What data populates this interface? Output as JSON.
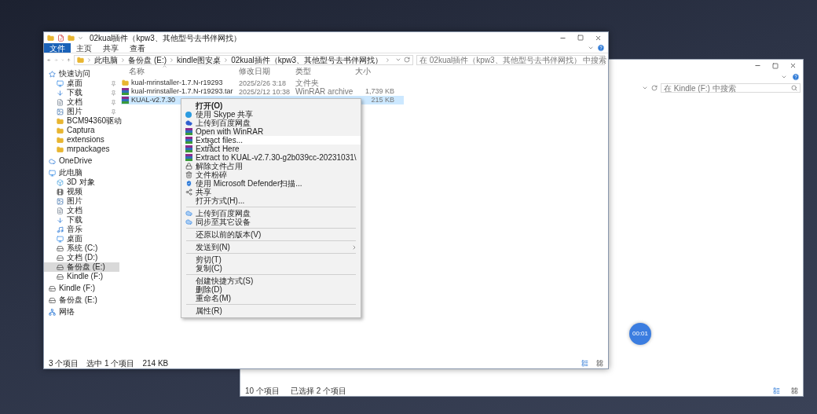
{
  "desktop": {
    "timer_badge": "00:01"
  },
  "back_window": {
    "search": {
      "placeholder": "在 Kindle (F:) 中搜索"
    },
    "status_bar": {
      "item_count": "10 个项目",
      "selection": "已选择 2 个项目"
    }
  },
  "window": {
    "title": "02kual插件（kpw3、其他型号去书伴网找）",
    "ribbon_tabs": [
      {
        "label": "文件",
        "selected": true
      },
      {
        "label": "主页",
        "selected": false
      },
      {
        "label": "共享",
        "selected": false
      },
      {
        "label": "查看",
        "selected": false
      }
    ],
    "address": {
      "path": [
        "此电脑",
        "备份盘 (E:)",
        "kindle图安桌",
        "02kual插件（kpw3、其他型号去书伴网找）"
      ]
    },
    "search": {
      "placeholder": "在 02kual插件（kpw3、其他型号去书伴网找） 中搜索"
    },
    "nav": [
      {
        "label": "快速访问",
        "kind": "star",
        "selected": false,
        "children": [
          {
            "label": "桌面",
            "kind": "desktop",
            "selected": false,
            "pinned": true
          },
          {
            "label": "下载",
            "kind": "download",
            "selected": false,
            "pinned": true
          },
          {
            "label": "文档",
            "kind": "document",
            "selected": false,
            "pinned": true
          },
          {
            "label": "图片",
            "kind": "picture",
            "selected": false,
            "pinned": true
          },
          {
            "label": "BCM94360驱动",
            "kind": "folder",
            "selected": false,
            "pinned": false
          },
          {
            "label": "Captura",
            "kind": "folder",
            "selected": false,
            "pinned": false
          },
          {
            "label": "extensions",
            "kind": "folder",
            "selected": false,
            "pinned": false
          },
          {
            "label": "mrpackages",
            "kind": "folder",
            "selected": false,
            "pinned": false
          }
        ]
      },
      {
        "label": "OneDrive",
        "kind": "cloud",
        "selected": false
      },
      {
        "label": "此电脑",
        "kind": "pc",
        "selected": false,
        "children": [
          {
            "label": "3D 对象",
            "kind": "cube",
            "selected": false
          },
          {
            "label": "视频",
            "kind": "video",
            "selected": false
          },
          {
            "label": "图片",
            "kind": "picture",
            "selected": false
          },
          {
            "label": "文档",
            "kind": "document",
            "selected": false
          },
          {
            "label": "下载",
            "kind": "download",
            "selected": false
          },
          {
            "label": "音乐",
            "kind": "music",
            "selected": false
          },
          {
            "label": "桌面",
            "kind": "desktop",
            "selected": false
          },
          {
            "label": "系统 (C:)",
            "kind": "drive",
            "selected": false
          },
          {
            "label": "文档 (D:)",
            "kind": "drive",
            "selected": false
          },
          {
            "label": "备份盘 (E:)",
            "kind": "drive",
            "selected": true
          },
          {
            "label": "Kindle (F:)",
            "kind": "drive",
            "selected": false
          }
        ]
      },
      {
        "label": "Kindle (F:)",
        "kind": "drive",
        "selected": false
      },
      {
        "label": "备份盘 (E:)",
        "kind": "drive",
        "selected": false
      },
      {
        "label": "网络",
        "kind": "network",
        "selected": false
      }
    ],
    "table": {
      "columns": [
        "名称",
        "修改日期",
        "类型",
        "大小"
      ],
      "rows": [
        {
          "kind": "folder",
          "name": "kual-mrinstaller-1.7.N-r19293",
          "date": "2025/2/26 3:18",
          "type": "文件夹",
          "selected": false
        },
        {
          "kind": "archive",
          "name": "kual-mrinstaller-1.7.N-r19293.tar",
          "date": "2025/2/12 10:38",
          "type": "WinRAR archive",
          "size": "1,739 KB",
          "selected": false
        },
        {
          "kind": "archive",
          "name": "KUAL-v2.7.30",
          "size": "215 KB",
          "selected": true
        }
      ]
    },
    "status_bar": {
      "item_count": "3 个项目",
      "selection": "选中 1 个项目",
      "size": "214 KB"
    }
  },
  "context_menu": [
    {
      "kind": "plain",
      "label": "打开(O)",
      "default": true,
      "highlighted": false
    },
    {
      "kind": "skype",
      "label": "使用 Skype 共享",
      "highlighted": false
    },
    {
      "kind": "baidu",
      "label": "上传到百度网盘",
      "highlighted": false
    },
    {
      "kind": "winrar",
      "label": "Open with WinRAR",
      "highlighted": false
    },
    {
      "kind": "winrar",
      "label": "Extract files...",
      "highlighted": true
    },
    {
      "kind": "winrar",
      "label": "Extract Here",
      "highlighted": false
    },
    {
      "kind": "winrar",
      "label": "Extract to KUAL-v2.7.30-g2b039cc-20231031\\",
      "highlighted": false
    },
    {
      "kind": "lock",
      "label": "解除文件占用",
      "highlighted": false
    },
    {
      "kind": "shred",
      "label": "文件粉碎",
      "highlighted": false
    },
    {
      "kind": "shield",
      "label": "使用 Microsoft Defender扫描...",
      "highlighted": false
    },
    {
      "kind": "share",
      "label": "共享",
      "highlighted": false
    },
    {
      "kind": "plain",
      "label": "打开方式(H)...",
      "highlighted": false
    },
    {
      "kind": "separator"
    },
    {
      "kind": "cloud",
      "label": "上传到百度网盘",
      "highlighted": false
    },
    {
      "kind": "cloud",
      "label": "同步至其它设备",
      "highlighted": false
    },
    {
      "kind": "separator"
    },
    {
      "kind": "plain",
      "label": "还原以前的版本(V)",
      "highlighted": false
    },
    {
      "kind": "separator"
    },
    {
      "kind": "plain",
      "label": "发送到(N)",
      "submenu": true,
      "highlighted": false
    },
    {
      "kind": "separator"
    },
    {
      "kind": "plain",
      "label": "剪切(T)",
      "highlighted": false
    },
    {
      "kind": "plain",
      "label": "复制(C)",
      "highlighted": false
    },
    {
      "kind": "separator"
    },
    {
      "kind": "plain",
      "label": "创建快捷方式(S)",
      "highlighted": false
    },
    {
      "kind": "plain",
      "label": "删除(D)",
      "highlighted": false
    },
    {
      "kind": "plain",
      "label": "重命名(M)",
      "highlighted": false
    },
    {
      "kind": "separator"
    },
    {
      "kind": "plain",
      "label": "属性(R)",
      "highlighted": false
    }
  ]
}
